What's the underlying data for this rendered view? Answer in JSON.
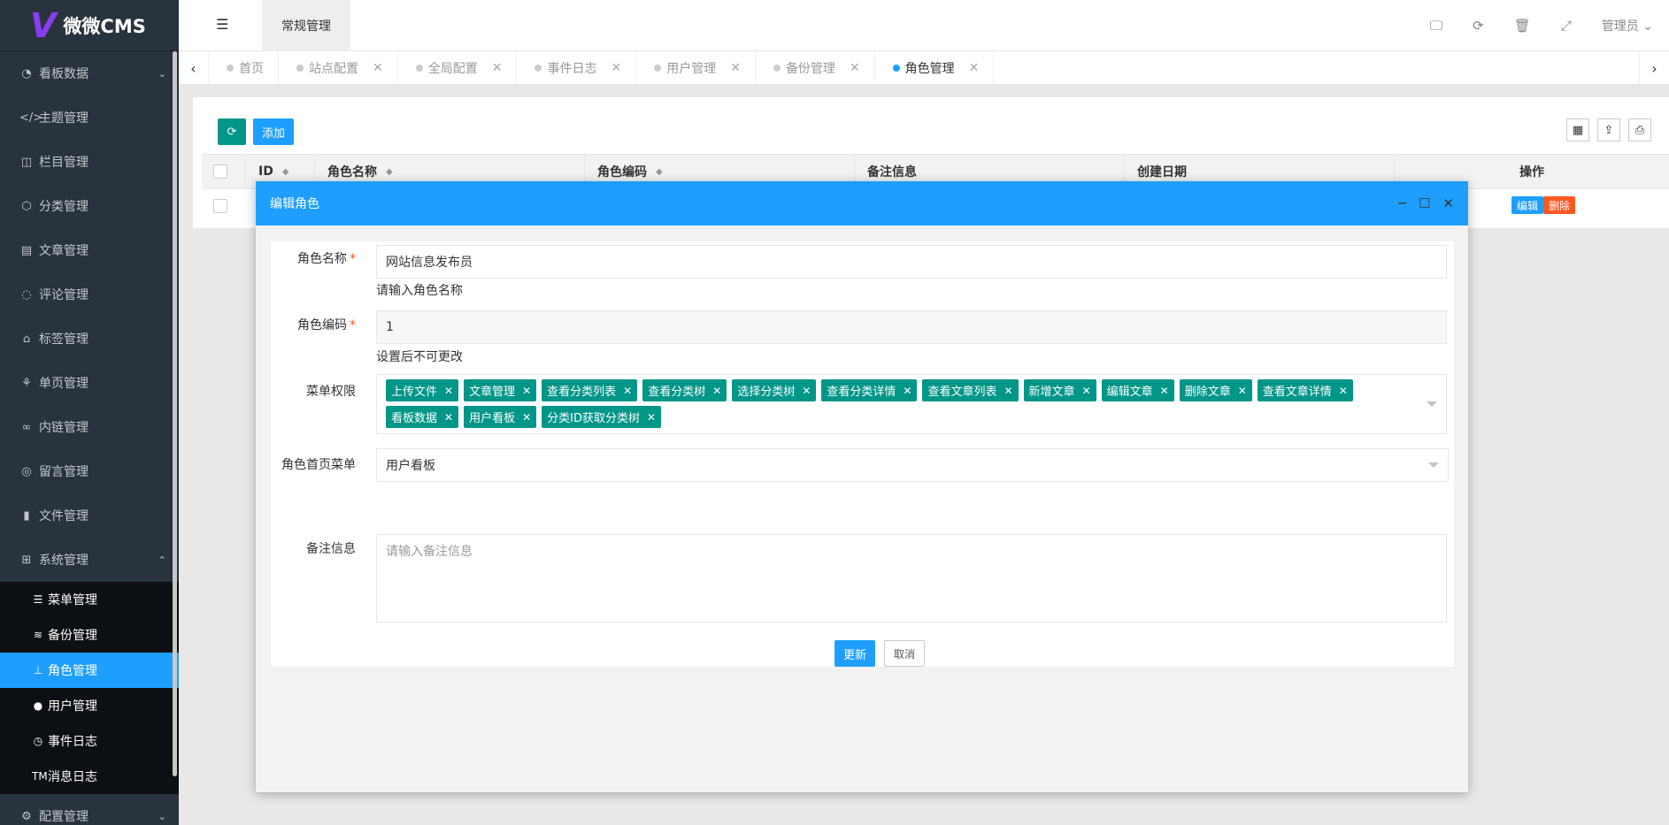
{
  "brand": {
    "mark": "V",
    "name": "微微CMS"
  },
  "header": {
    "top_tab": "常规管理",
    "user": "管理员 ⌄"
  },
  "sidebar": {
    "items": [
      {
        "icon": "dashboard-icon",
        "glyph": "◔",
        "label": "看板数据",
        "arrow": "⌄"
      },
      {
        "icon": "code-icon",
        "glyph": "</>",
        "label": "主题管理"
      },
      {
        "icon": "columns-icon",
        "glyph": "◫",
        "label": "栏目管理"
      },
      {
        "icon": "cube-icon",
        "glyph": "⬡",
        "label": "分类管理"
      },
      {
        "icon": "book-icon",
        "glyph": "▤",
        "label": "文章管理"
      },
      {
        "icon": "comment-icon",
        "glyph": "◌",
        "label": "评论管理"
      },
      {
        "icon": "tags-icon",
        "glyph": "⌂",
        "label": "标签管理"
      },
      {
        "icon": "page-icon",
        "glyph": "⚘",
        "label": "单页管理"
      },
      {
        "icon": "link-icon",
        "glyph": "∞",
        "label": "内链管理"
      },
      {
        "icon": "message-icon",
        "glyph": "◎",
        "label": "留言管理"
      },
      {
        "icon": "file-icon",
        "glyph": "▮",
        "label": "文件管理"
      },
      {
        "icon": "windows-icon",
        "glyph": "⊞",
        "label": "系统管理",
        "arrow": "⌃"
      }
    ],
    "sub_items": [
      {
        "icon": "list-icon",
        "glyph": "☰",
        "label": "菜单管理"
      },
      {
        "icon": "database-icon",
        "glyph": "≋",
        "label": "备份管理"
      },
      {
        "icon": "stamp-icon",
        "glyph": "⊥",
        "label": "角色管理",
        "active": true
      },
      {
        "icon": "user-icon",
        "glyph": "●",
        "label": "用户管理"
      },
      {
        "icon": "clock-icon",
        "glyph": "◷",
        "label": "事件日志"
      },
      {
        "icon": "trademark-icon",
        "glyph": "TM",
        "label": "消息日志"
      }
    ],
    "bottom_item": {
      "label": "配置管理",
      "arrow": "⌄"
    }
  },
  "tabs": [
    {
      "label": "首页",
      "closable": false
    },
    {
      "label": "站点配置",
      "closable": true
    },
    {
      "label": "全局配置",
      "closable": true
    },
    {
      "label": "事件日志",
      "closable": true
    },
    {
      "label": "用户管理",
      "closable": true
    },
    {
      "label": "备份管理",
      "closable": true
    },
    {
      "label": "角色管理",
      "closable": true,
      "active": true
    }
  ],
  "toolbar": {
    "add_label": "添加"
  },
  "table": {
    "columns": [
      "ID",
      "角色名称",
      "角色编码",
      "备注信息",
      "创建日期",
      "操作"
    ],
    "row_actions": {
      "edit": "编辑",
      "delete": "删除"
    }
  },
  "modal": {
    "title": "编辑角色",
    "fields": {
      "name_label": "角色名称",
      "name_value": "网站信息发布员",
      "name_tip": "请输入角色名称",
      "code_label": "角色编码",
      "code_value": "1",
      "code_tip": "设置后不可更改",
      "menu_label": "菜单权限",
      "menu_tags": [
        "上传文件",
        "文章管理",
        "查看分类列表",
        "查看分类树",
        "选择分类树",
        "查看分类详情",
        "查看文章列表",
        "新增文章",
        "编辑文章",
        "删除文章",
        "查看文章详情",
        "看板数据",
        "用户看板",
        "分类ID获取分类树"
      ],
      "home_label": "角色首页菜单",
      "home_value": "用户看板",
      "remark_label": "备注信息",
      "remark_placeholder": "请输入备注信息"
    },
    "buttons": {
      "update": "更新",
      "cancel": "取消"
    }
  },
  "colors": {
    "primary": "#1e9fff",
    "teal": "#009688",
    "danger": "#ff5722",
    "sidebar": "#28333e"
  }
}
